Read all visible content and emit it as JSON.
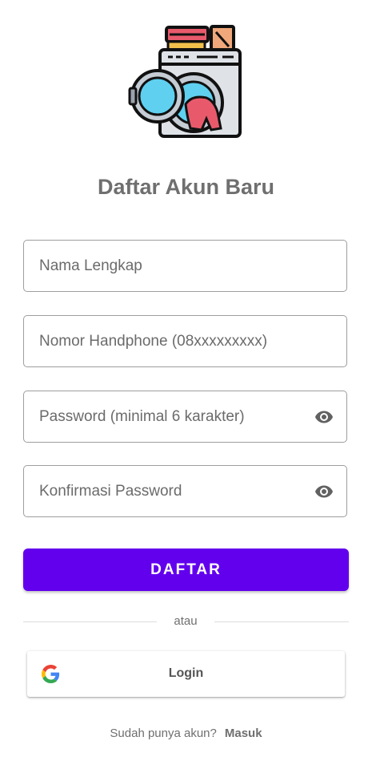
{
  "register": {
    "title": "Daftar Akun Baru",
    "fields": {
      "full_name": {
        "placeholder": "Nama Lengkap",
        "value": ""
      },
      "phone": {
        "placeholder": "Nomor Handphone (08xxxxxxxxx)",
        "value": ""
      },
      "password": {
        "placeholder": "Password (minimal 6 karakter)",
        "value": ""
      },
      "confirm_password": {
        "placeholder": "Konfirmasi Password",
        "value": ""
      }
    },
    "submit_label": "DAFTAR",
    "divider_text": "atau",
    "google_label": "Login",
    "footer_text": "Sudah punya akun?",
    "footer_link": "Masuk"
  },
  "icons": {
    "logo": "washing-machine-icon",
    "password_toggle": "eye-icon",
    "google": "google-icon"
  },
  "colors": {
    "primary": "#6200ee",
    "title": "#6f6f6f",
    "border": "#9e9e9e"
  }
}
